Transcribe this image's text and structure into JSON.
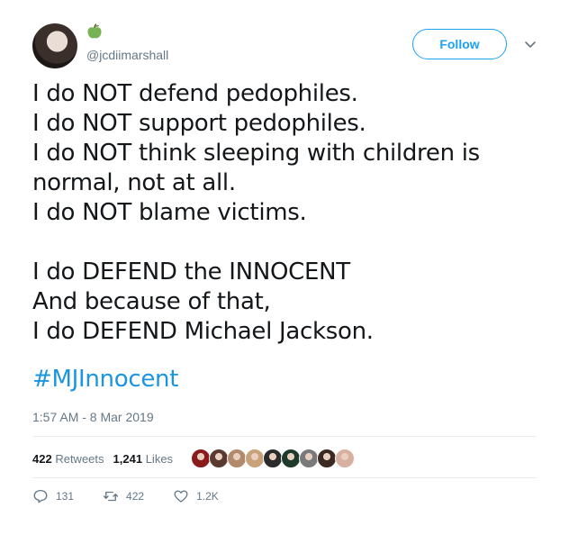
{
  "header": {
    "handle": "@jcdiimarshall",
    "follow_label": "Follow"
  },
  "tweet": {
    "lines": [
      "I do NOT defend pedophiles.",
      "I do NOT support pedophiles.",
      "I do NOT think sleeping with children is",
      "normal, not at all.",
      "I do NOT blame victims.",
      "I do DEFEND the INNOCENT",
      "And because of that,",
      "I do DEFEND Michael Jackson."
    ],
    "hashtag": "#MJInnocent",
    "timestamp": "1:57 AM - 8 Mar 2019"
  },
  "stats": {
    "retweets_count": "422",
    "retweets_label": "Retweets",
    "likes_count": "1,241",
    "likes_label": "Likes",
    "liker_colors": [
      "#8b1a1a",
      "#5a3a2e",
      "#b08a6a",
      "#c9a27a",
      "#2b2b2b",
      "#1e3a2a",
      "#7a7a7a",
      "#3a2a22",
      "#d8b0a0"
    ]
  },
  "actions": {
    "replies": "131",
    "retweets": "422",
    "likes": "1.2K"
  },
  "colors": {
    "accent": "#1da1f2",
    "link": "#1b95e0",
    "muted": "#657786",
    "apple": "#77b255"
  }
}
